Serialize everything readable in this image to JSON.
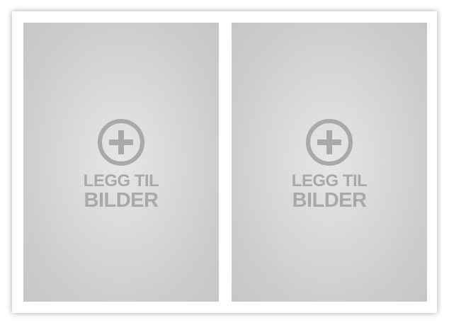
{
  "slots": [
    {
      "label_line1": "LEGG TIL",
      "label_line2": "BILDER",
      "icon": "plus-circle-icon"
    },
    {
      "label_line1": "LEGG TIL",
      "label_line2": "BILDER",
      "icon": "plus-circle-icon"
    }
  ],
  "colors": {
    "slot_background": "#cccccc",
    "slot_highlight": "#e6e6e6",
    "icon_and_text": "#a9a9a9",
    "frame": "#ffffff"
  }
}
